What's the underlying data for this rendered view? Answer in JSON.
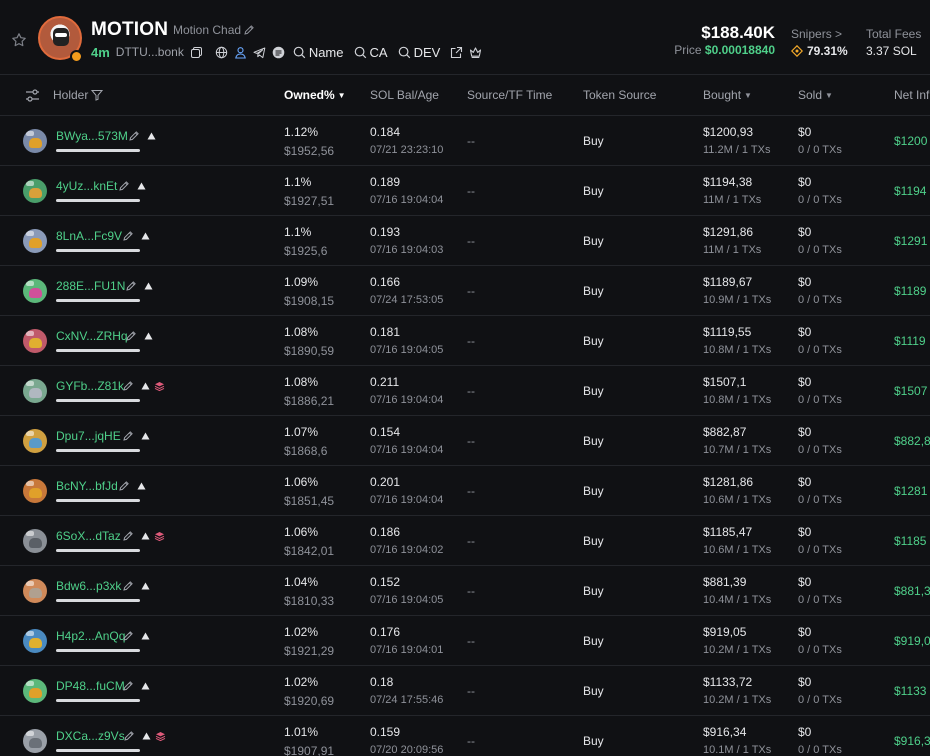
{
  "header": {
    "token_name": "MOTION",
    "token_subname": "Motion Chad",
    "age": "4m",
    "address_short": "DTTU...bonk",
    "links": [
      {
        "label": "Name"
      },
      {
        "label": "CA"
      },
      {
        "label": "DEV"
      }
    ],
    "market_cap": "$188.40K",
    "price_label": "Price",
    "price_value": "$0.00018840",
    "snipers_label": "Snipers >",
    "snipers_value": "79.31%",
    "fees_label": "Total Fees",
    "fees_value": "3.37 SOL"
  },
  "table": {
    "columns": {
      "holder": "Holder",
      "owned": "Owned%",
      "sol": "SOL Bal/Age",
      "source": "Source/TF Time",
      "token_source": "Token Source",
      "bought": "Bought",
      "sold": "Sold",
      "net": "Net Infl"
    },
    "rows": [
      {
        "holder": "BWya...573M",
        "owned": "1.12%",
        "owned_usd": "$1952,56",
        "sol": "0.184",
        "time": "07/21 23:23:10",
        "source": "--",
        "token_source": "Buy",
        "bought": "$1200,93",
        "bought_tx": "11.2M / 1 TXs",
        "sold": "$0",
        "sold_tx": "0 / 0 TXs",
        "net": "$1200",
        "edit": false,
        "stack": false,
        "avatar_color": "#7a8aa8",
        "blob_color": "#e0a02a"
      },
      {
        "holder": "4yUz...knEt",
        "owned": "1.1%",
        "owned_usd": "$1927,51",
        "sol": "0.189",
        "time": "07/16 19:04:04",
        "source": "--",
        "token_source": "Buy",
        "bought": "$1194,38",
        "bought_tx": "11M / 1 TXs",
        "sold": "$0",
        "sold_tx": "0 / 0 TXs",
        "net": "$1194",
        "edit": true,
        "stack": false,
        "avatar_color": "#4a9e6a",
        "blob_color": "#d8a03a"
      },
      {
        "holder": "8LnA...Fc9V",
        "owned": "1.1%",
        "owned_usd": "$1925,6",
        "sol": "0.193",
        "time": "07/16 19:04:03",
        "source": "--",
        "token_source": "Buy",
        "bought": "$1291,86",
        "bought_tx": "11M / 1 TXs",
        "sold": "$0",
        "sold_tx": "0 / 0 TXs",
        "net": "$1291",
        "edit": true,
        "stack": false,
        "avatar_color": "#8a9ab8",
        "blob_color": "#e0a02a"
      },
      {
        "holder": "288E...FU1N",
        "owned": "1.09%",
        "owned_usd": "$1908,15",
        "sol": "0.166",
        "time": "07/24 17:53:05",
        "source": "--",
        "token_source": "Buy",
        "bought": "$1189,67",
        "bought_tx": "10.9M / 1 TXs",
        "sold": "$0",
        "sold_tx": "0 / 0 TXs",
        "net": "$1189",
        "edit": true,
        "stack": false,
        "avatar_color": "#5cb87a",
        "blob_color": "#d0509a"
      },
      {
        "holder": "CxNV...ZRHq",
        "owned": "1.08%",
        "owned_usd": "$1890,59",
        "sol": "0.181",
        "time": "07/16 19:04:05",
        "source": "--",
        "token_source": "Buy",
        "bought": "$1119,55",
        "bought_tx": "10.8M / 1 TXs",
        "sold": "$0",
        "sold_tx": "0 / 0 TXs",
        "net": "$1119",
        "edit": false,
        "stack": false,
        "avatar_color": "#c05a6a",
        "blob_color": "#e0b030"
      },
      {
        "holder": "GYFb...Z81k",
        "owned": "1.08%",
        "owned_usd": "$1886,21",
        "sol": "0.211",
        "time": "07/16 19:04:04",
        "source": "--",
        "token_source": "Buy",
        "bought": "$1507,1",
        "bought_tx": "10.8M / 1 TXs",
        "sold": "$0",
        "sold_tx": "0 / 0 TXs",
        "net": "$1507",
        "edit": true,
        "stack": true,
        "avatar_color": "#7aa890",
        "blob_color": "#b0b8c0"
      },
      {
        "holder": "Dpu7...jqHE",
        "owned": "1.07%",
        "owned_usd": "$1868,6",
        "sol": "0.154",
        "time": "07/16 19:04:04",
        "source": "--",
        "token_source": "Buy",
        "bought": "$882,87",
        "bought_tx": "10.7M / 1 TXs",
        "sold": "$0",
        "sold_tx": "0 / 0 TXs",
        "net": "$882,8",
        "edit": true,
        "stack": false,
        "avatar_color": "#d0a040",
        "blob_color": "#5a9ac8"
      },
      {
        "holder": "BcNY...bfJd",
        "owned": "1.06%",
        "owned_usd": "$1851,45",
        "sol": "0.201",
        "time": "07/16 19:04:04",
        "source": "--",
        "token_source": "Buy",
        "bought": "$1281,86",
        "bought_tx": "10.6M / 1 TXs",
        "sold": "$0",
        "sold_tx": "0 / 0 TXs",
        "net": "$1281",
        "edit": true,
        "stack": false,
        "avatar_color": "#c8783a",
        "blob_color": "#e0a02a"
      },
      {
        "holder": "6SoX...dTaz",
        "owned": "1.06%",
        "owned_usd": "$1842,01",
        "sol": "0.186",
        "time": "07/16 19:04:02",
        "source": "--",
        "token_source": "Buy",
        "bought": "$1185,47",
        "bought_tx": "10.6M / 1 TXs",
        "sold": "$0",
        "sold_tx": "0 / 0 TXs",
        "net": "$1185",
        "edit": true,
        "stack": true,
        "avatar_color": "#8a8f96",
        "blob_color": "#5a5f66"
      },
      {
        "holder": "Bdw6...p3xk",
        "owned": "1.04%",
        "owned_usd": "$1810,33",
        "sol": "0.152",
        "time": "07/16 19:04:05",
        "source": "--",
        "token_source": "Buy",
        "bought": "$881,39",
        "bought_tx": "10.4M / 1 TXs",
        "sold": "$0",
        "sold_tx": "0 / 0 TXs",
        "net": "$881,3",
        "edit": true,
        "stack": false,
        "avatar_color": "#d08a5a",
        "blob_color": "#b0a090"
      },
      {
        "holder": "H4p2...AnQq",
        "owned": "1.02%",
        "owned_usd": "$1921,29",
        "sol": "0.176",
        "time": "07/16 19:04:01",
        "source": "--",
        "token_source": "Buy",
        "bought": "$919,05",
        "bought_tx": "10.2M / 1 TXs",
        "sold": "$0",
        "sold_tx": "0 / 0 TXs",
        "net": "$919,0",
        "edit": true,
        "stack": false,
        "avatar_color": "#4a8ac0",
        "blob_color": "#e0b030"
      },
      {
        "holder": "DP48...fuCM",
        "owned": "1.02%",
        "owned_usd": "$1920,69",
        "sol": "0.18",
        "time": "07/24 17:55:46",
        "source": "--",
        "token_source": "Buy",
        "bought": "$1133,72",
        "bought_tx": "10.2M / 1 TXs",
        "sold": "$0",
        "sold_tx": "0 / 0 TXs",
        "net": "$1133",
        "edit": false,
        "stack": false,
        "avatar_color": "#5cb87a",
        "blob_color": "#e0a02a"
      },
      {
        "holder": "DXCa...z9Vs",
        "owned": "1.01%",
        "owned_usd": "$1907,91",
        "sol": "0.159",
        "time": "07/20 20:09:56",
        "source": "--",
        "token_source": "Buy",
        "bought": "$916,34",
        "bought_tx": "10.1M / 1 TXs",
        "sold": "$0",
        "sold_tx": "0 / 0 TXs",
        "net": "$916,3",
        "edit": true,
        "stack": true,
        "avatar_color": "#9aa0a8",
        "blob_color": "#6a7078"
      }
    ]
  }
}
